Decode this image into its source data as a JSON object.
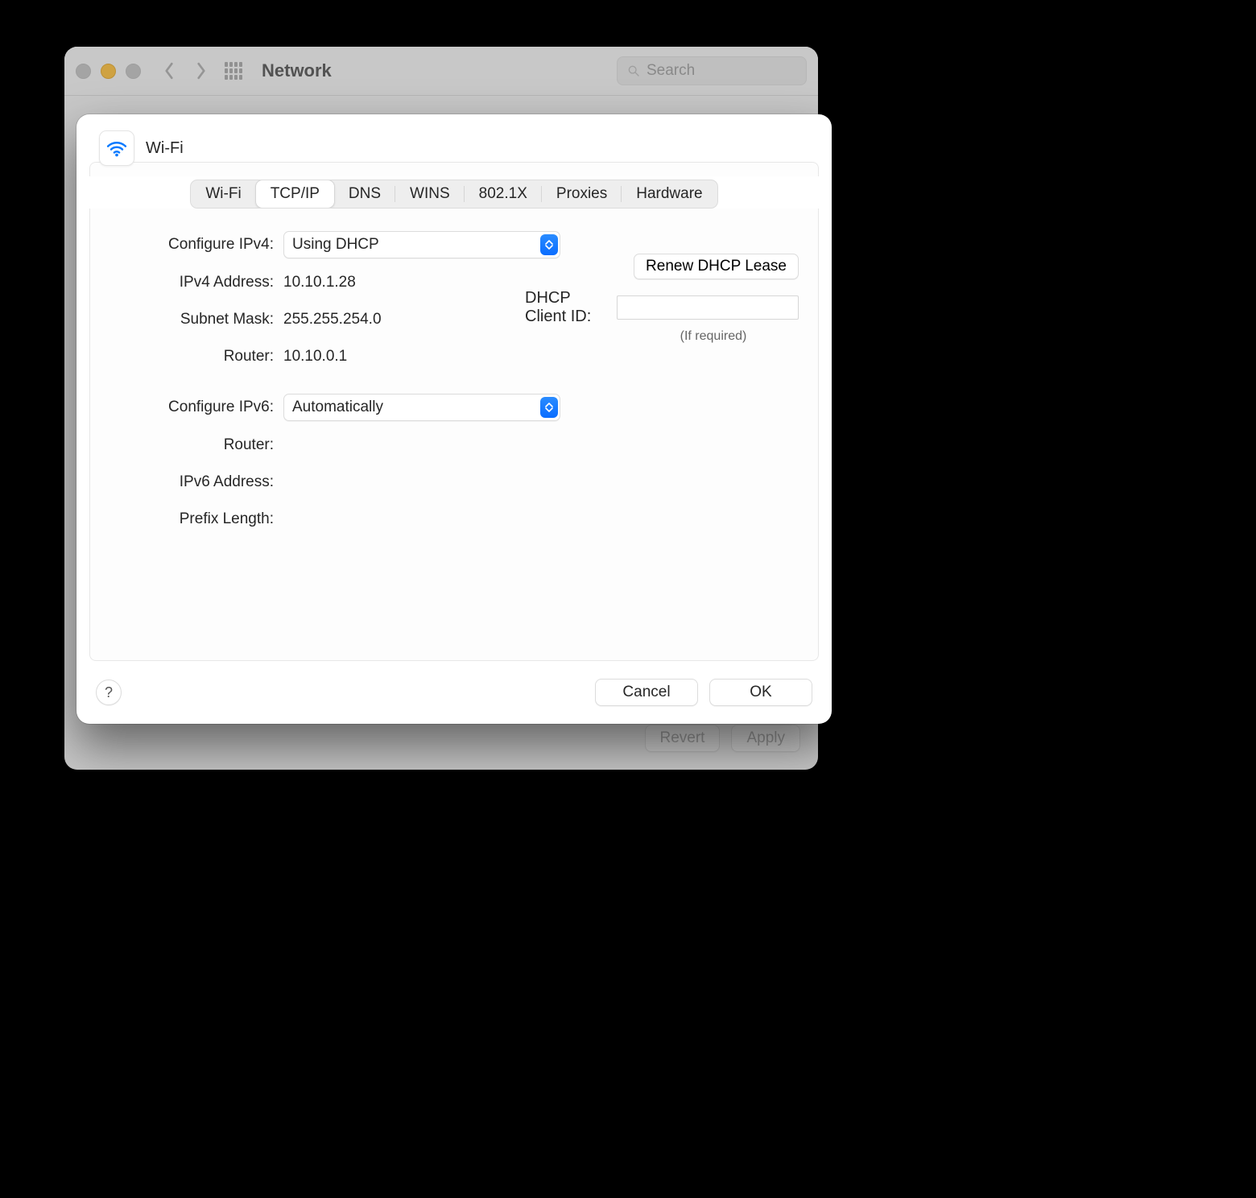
{
  "syspref": {
    "title": "Network",
    "search_placeholder": "Search",
    "revert_label": "Revert",
    "apply_label": "Apply"
  },
  "sheet": {
    "interface_name": "Wi-Fi",
    "tabs": [
      "Wi-Fi",
      "TCP/IP",
      "DNS",
      "WINS",
      "802.1X",
      "Proxies",
      "Hardware"
    ],
    "active_tab_index": 1,
    "ipv4": {
      "configure_label": "Configure IPv4:",
      "configure_value": "Using DHCP",
      "address_label": "IPv4 Address:",
      "address_value": "10.10.1.28",
      "subnet_label": "Subnet Mask:",
      "subnet_value": "255.255.254.0",
      "router_label": "Router:",
      "router_value": "10.10.0.1",
      "renew_label": "Renew DHCP Lease",
      "client_id_label": "DHCP Client ID:",
      "client_id_value": "",
      "client_id_hint": "(If required)"
    },
    "ipv6": {
      "configure_label": "Configure IPv6:",
      "configure_value": "Automatically",
      "router_label": "Router:",
      "router_value": "",
      "address_label": "IPv6 Address:",
      "address_value": "",
      "prefix_label": "Prefix Length:",
      "prefix_value": ""
    },
    "cancel_label": "Cancel",
    "ok_label": "OK",
    "help_label": "?"
  }
}
